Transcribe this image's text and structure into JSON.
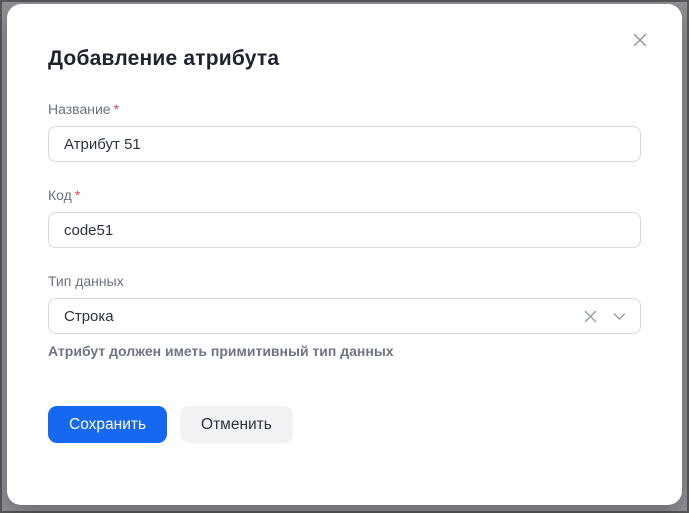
{
  "modal": {
    "title": "Добавление атрибута",
    "required_mark": "*",
    "fields": [
      {
        "label": "Название",
        "required": true,
        "type": "text",
        "value": "Атрибут 51"
      },
      {
        "label": "Код",
        "required": true,
        "type": "text",
        "value": "code51"
      },
      {
        "label": "Тип данных",
        "required": false,
        "type": "select",
        "value": "Строка",
        "helper": "Атрибут должен иметь примитивный тип данных"
      }
    ],
    "buttons": {
      "save": "Сохранить",
      "cancel": "Отменить"
    },
    "icons": {
      "close": "close-icon",
      "clear": "clear-icon",
      "chevron": "chevron-down-icon"
    }
  },
  "colors": {
    "primary": "#1668f0",
    "primary_text": "#ffffff",
    "cancel_bg": "#f1f2f4",
    "title": "#1d2430",
    "label": "#697280",
    "value_text": "#2b3342",
    "border": "#d5d9e0",
    "required": "#e5484d",
    "helper": "#6d7585",
    "backdrop": "#909298",
    "icon": "#98a1af"
  }
}
